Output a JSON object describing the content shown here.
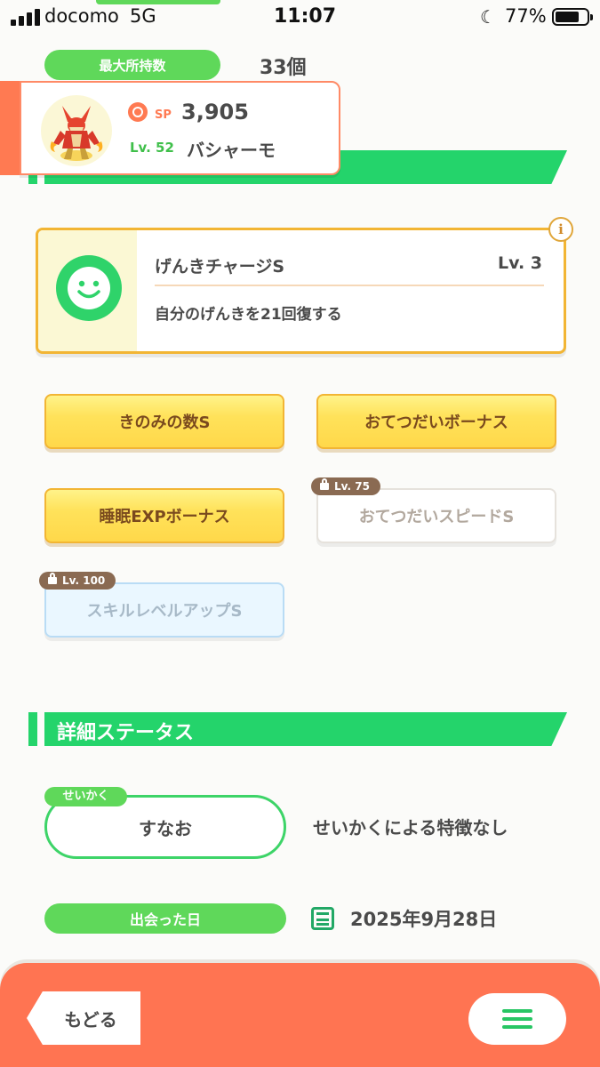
{
  "status_bar": {
    "carrier": "docomo",
    "network": "5G",
    "time": "11:07",
    "battery_percent": "77%",
    "moon_icon": "☾",
    "battery_level": 0.77
  },
  "summary": {
    "max_holding_label": "最大所持数",
    "max_holding_value": "33個"
  },
  "pokemon": {
    "sp_label": "SP",
    "sp_value": "3,905",
    "level_label": "Lv. 52",
    "name": "バシャーモ"
  },
  "main_skill": {
    "name": "げんきチャージS",
    "level": "Lv. 3",
    "description": "自分のげんきを21回復する",
    "info_label": "i"
  },
  "sub_skills": [
    {
      "label": "きのみの数S",
      "locked": false
    },
    {
      "label": "おてつだいボーナス",
      "locked": false
    },
    {
      "label": "睡眠EXPボーナス",
      "locked": false
    },
    {
      "label": "おてつだいスピードS",
      "locked": true,
      "unlock_label": "Lv. 75"
    },
    {
      "label": "スキルレベルアップS",
      "locked": true,
      "unlock_label": "Lv. 100"
    }
  ],
  "details": {
    "section_title": "詳細ステータス",
    "nature_tag": "せいかく",
    "nature_value": "すなお",
    "nature_description": "せいかくによる特徴なし",
    "met_date_label": "出会った日",
    "met_date_value": "2025年9月28日"
  },
  "footer": {
    "back_label": "もどる",
    "menu_icon": "menu-icon"
  },
  "colors": {
    "green": "#24d46b",
    "light_green": "#5fd85a",
    "orange": "#ff7452",
    "gold": "#f2b534"
  }
}
